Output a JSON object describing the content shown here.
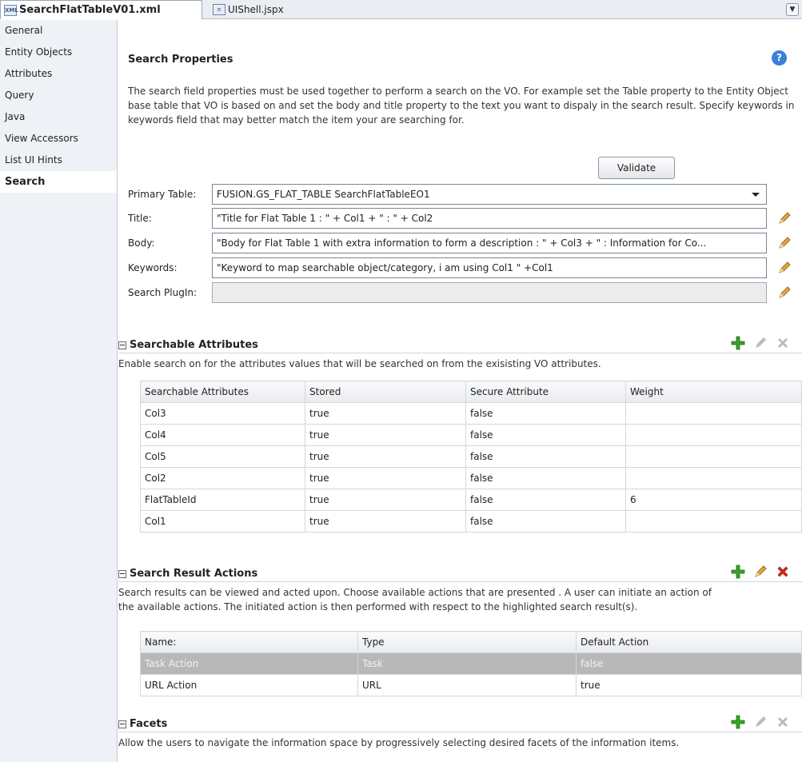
{
  "tabs": [
    {
      "label": "SearchFlatTableV01.xml",
      "icon": "xml-file-icon"
    },
    {
      "label": "UIShell.jspx",
      "icon": "jspx-file-icon"
    }
  ],
  "sidebar": {
    "items": [
      {
        "label": "General"
      },
      {
        "label": "Entity Objects"
      },
      {
        "label": "Attributes"
      },
      {
        "label": "Query"
      },
      {
        "label": "Java"
      },
      {
        "label": "View Accessors"
      },
      {
        "label": "List UI Hints"
      },
      {
        "label": "Search",
        "selected": true
      }
    ]
  },
  "search_properties": {
    "title": "Search Properties",
    "description": "The search field properties must be used together to perform a search on the VO. For example set the Table property to the Entity Object base table that VO is based on and set the body and title property to the text you want to dispaly in the search result. Specify keywords in keywords field that may better match the item your are searching for.",
    "validate_label": "Validate",
    "fields": {
      "primary_table": {
        "label": "Primary Table:",
        "value": "FUSION.GS_FLAT_TABLE SearchFlatTableEO1"
      },
      "title": {
        "label": "Title:",
        "value": "\"Title for Flat Table 1 : \" + Col1 + \" : \" + Col2"
      },
      "body": {
        "label": "Body:",
        "value": "\"Body for Flat Table 1 with extra information to form a description : \" + Col3  + \" : Information for Co..."
      },
      "keywords": {
        "label": "Keywords:",
        "value": "\"Keyword to map searchable object/category, i am using Col1 \" +Col1"
      },
      "search_plugin": {
        "label": "Search PlugIn:",
        "value": ""
      }
    }
  },
  "searchable_attributes": {
    "title": "Searchable Attributes",
    "description": "Enable search on for the attributes values that will be searched on from the exisisting VO attributes.",
    "columns": [
      "Searchable Attributes",
      "Stored",
      "Secure Attribute",
      "Weight"
    ],
    "rows": [
      [
        "Col3",
        "true",
        "false",
        ""
      ],
      [
        "Col4",
        "true",
        "false",
        ""
      ],
      [
        "Col5",
        "true",
        "false",
        ""
      ],
      [
        "Col2",
        "true",
        "false",
        ""
      ],
      [
        "FlatTableId",
        "true",
        "false",
        "6"
      ],
      [
        "Col1",
        "true",
        "false",
        ""
      ]
    ]
  },
  "search_result_actions": {
    "title": "Search Result Actions",
    "description_line1": "Search results can be viewed and acted upon. Choose available actions that are presented . A user can initiate an action of",
    "description_line2": "the available actions. The initiated action is then performed with respect to the highlighted search result(s).",
    "columns": [
      "Name:",
      "Type",
      "Default Action"
    ],
    "rows": [
      [
        "Task Action",
        "Task",
        "false"
      ],
      [
        "URL Action",
        "URL",
        "true"
      ]
    ],
    "highlighted_row": 0
  },
  "facets": {
    "title": "Facets",
    "description": "Allow the users to navigate the information space by progressively selecting desired facets of the information items."
  },
  "colors": {
    "add": "#3aa12b",
    "delete_active": "#d8261b",
    "icon_disabled": "#b5bcc4",
    "highlight_row": "#b8b8b8"
  }
}
